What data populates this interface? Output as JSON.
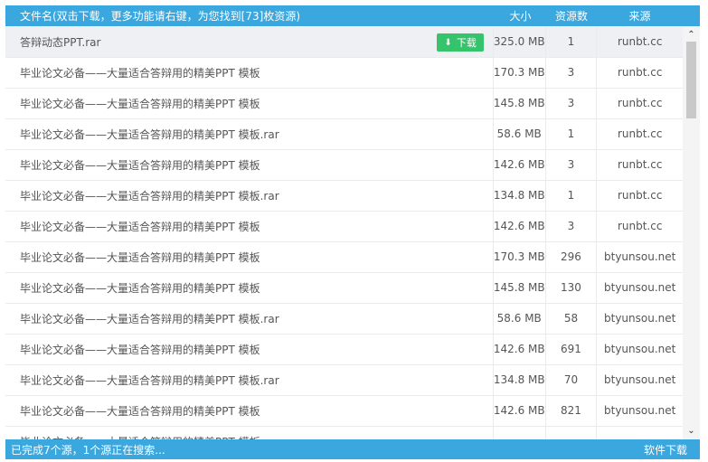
{
  "header": {
    "name": "文件名(双击下载，更多功能请右键，为您找到[73]枚资源)",
    "size": "大小",
    "resources": "资源数",
    "source": "来源"
  },
  "download_label": "下载",
  "rows": [
    {
      "name": "答辩动态PPT.rar",
      "size": "325.0 MB",
      "res": "1",
      "src": "runbt.cc"
    },
    {
      "name": "毕业论文必备——大量适合答辩用的精美PPT 模板",
      "size": "170.3 MB",
      "res": "3",
      "src": "runbt.cc"
    },
    {
      "name": "毕业论文必备——大量适合答辩用的精美PPT 模板",
      "size": "145.8 MB",
      "res": "3",
      "src": "runbt.cc"
    },
    {
      "name": "毕业论文必备——大量适合答辩用的精美PPT 模板.rar",
      "size": "58.6 MB",
      "res": "1",
      "src": "runbt.cc"
    },
    {
      "name": "毕业论文必备——大量适合答辩用的精美PPT 模板",
      "size": "142.6 MB",
      "res": "3",
      "src": "runbt.cc"
    },
    {
      "name": "毕业论文必备——大量适合答辩用的精美PPT 模板.rar",
      "size": "134.8 MB",
      "res": "1",
      "src": "runbt.cc"
    },
    {
      "name": "毕业论文必备——大量适合答辩用的精美PPT 模板",
      "size": "142.6 MB",
      "res": "3",
      "src": "runbt.cc"
    },
    {
      "name": "毕业论文必备——大量适合答辩用的精美PPT 模板",
      "size": "170.3 MB",
      "res": "296",
      "src": "btyunsou.net"
    },
    {
      "name": "毕业论文必备——大量适合答辩用的精美PPT 模板",
      "size": "145.8 MB",
      "res": "130",
      "src": "btyunsou.net"
    },
    {
      "name": "毕业论文必备——大量适合答辩用的精美PPT 模板.rar",
      "size": "58.6 MB",
      "res": "58",
      "src": "btyunsou.net"
    },
    {
      "name": "毕业论文必备——大量适合答辩用的精美PPT 模板",
      "size": "142.6 MB",
      "res": "691",
      "src": "btyunsou.net"
    },
    {
      "name": "毕业论文必备——大量适合答辩用的精美PPT 模板.rar",
      "size": "134.8 MB",
      "res": "70",
      "src": "btyunsou.net"
    },
    {
      "name": "毕业论文必备——大量适合答辩用的精美PPT 模板",
      "size": "142.6 MB",
      "res": "821",
      "src": "btyunsou.net"
    },
    {
      "name": "毕业论文必备——大量适合答辩用的精美PPT 模板",
      "size": "",
      "res": "",
      "src": ""
    }
  ],
  "status": {
    "left": "已完成7个源，1个源正在搜索...",
    "right": "软件下载"
  },
  "icons": {
    "download": "arrow-down-icon",
    "scroll_up": "chevron-up-icon",
    "scroll_down": "chevron-down-icon"
  },
  "colors": {
    "header_bg": "#3aa7df",
    "download_btn": "#35c46b",
    "selected_row": "#eef0f3"
  }
}
